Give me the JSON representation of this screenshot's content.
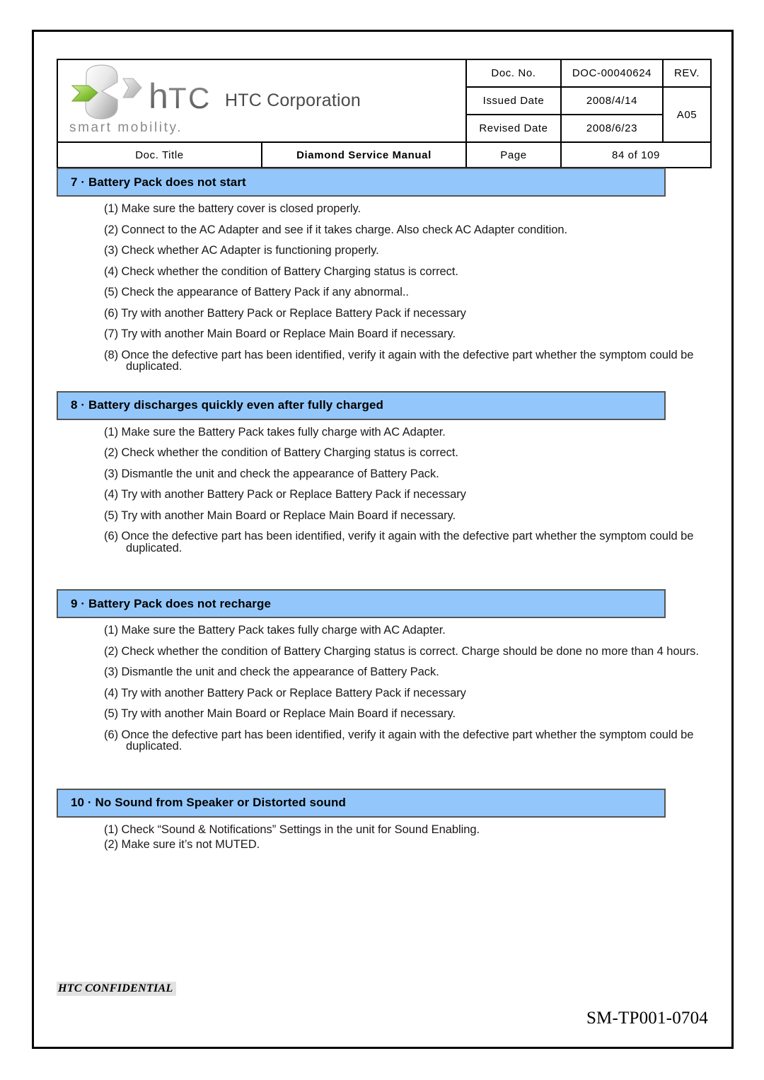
{
  "header": {
    "company_name": "HTC Corporation",
    "logo_wordmark": "hTC",
    "logo_tagline": "smart mobility.",
    "fields": {
      "doc_no_label": "Doc. No.",
      "doc_no_value": "DOC-00040624",
      "rev_label": "REV.",
      "rev_value": "A05",
      "issued_date_label": "Issued Date",
      "issued_date_value": "2008/4/14",
      "revised_date_label": "Revised Date",
      "revised_date_value": "2008/6/23",
      "doc_title_label": "Doc. Title",
      "doc_title_value": "Diamond Service Manual",
      "page_label": "Page",
      "page_value": "84 of 109"
    }
  },
  "colors": {
    "heading_blue": "#93c7fb",
    "heading_border": "#555555",
    "confidential_bg": "#e2e2e2",
    "logo_green": "#8cc63f"
  },
  "sections": [
    {
      "heading": "7 · Battery Pack does not start",
      "steps": [
        "(1) Make sure the battery cover is closed properly.",
        "(2) Connect to the AC Adapter and see if it takes charge. Also check AC Adapter condition.",
        "(3) Check whether AC Adapter is functioning properly.",
        "(4) Check whether the condition of Battery Charging status is correct.",
        "(5) Check the appearance of Battery Pack if any abnormal..",
        "(6) Try with another Battery Pack or Replace Battery Pack if necessary",
        "(7) Try with another Main Board or Replace Main Board if necessary.",
        "(8) Once the defective part has been identified, verify it again with the defective part whether the symptom could be duplicated."
      ]
    },
    {
      "heading": "8 · Battery discharges quickly even after fully charged",
      "steps": [
        "(1) Make sure the Battery Pack takes fully charge with AC Adapter.",
        "(2) Check whether the condition of Battery Charging status is correct.",
        "(3) Dismantle the unit and check the appearance of Battery Pack.",
        "(4) Try with another Battery Pack or Replace Battery Pack if necessary",
        "(5) Try with another Main Board or Replace Main Board if necessary.",
        "(6) Once the defective part has been identified, verify it again with the defective part whether the symptom could be duplicated."
      ]
    },
    {
      "heading": "9 · Battery Pack does not recharge",
      "steps": [
        "(1) Make sure the Battery Pack takes fully charge with AC Adapter.",
        "(2) Check whether the condition of Battery Charging status is correct. Charge should be done no more than 4 hours.",
        "(3) Dismantle the unit and check the appearance of Battery Pack.",
        "(4) Try with another Battery Pack or Replace Battery Pack if necessary",
        "(5) Try with another Main Board or Replace Main Board if necessary.",
        "(6) Once the defective part has been identified, verify it again with the defective part whether the symptom could be duplicated."
      ]
    },
    {
      "heading": "10 · No Sound from Speaker or Distorted sound",
      "steps": [
        "(1) Check “Sound & Notifications” Settings in the unit for Sound Enabling.",
        "(2) Make sure it’s not MUTED."
      ]
    }
  ],
  "footer": {
    "confidential": "HTC CONFIDENTIAL",
    "form_code": "SM-TP001-0704"
  }
}
